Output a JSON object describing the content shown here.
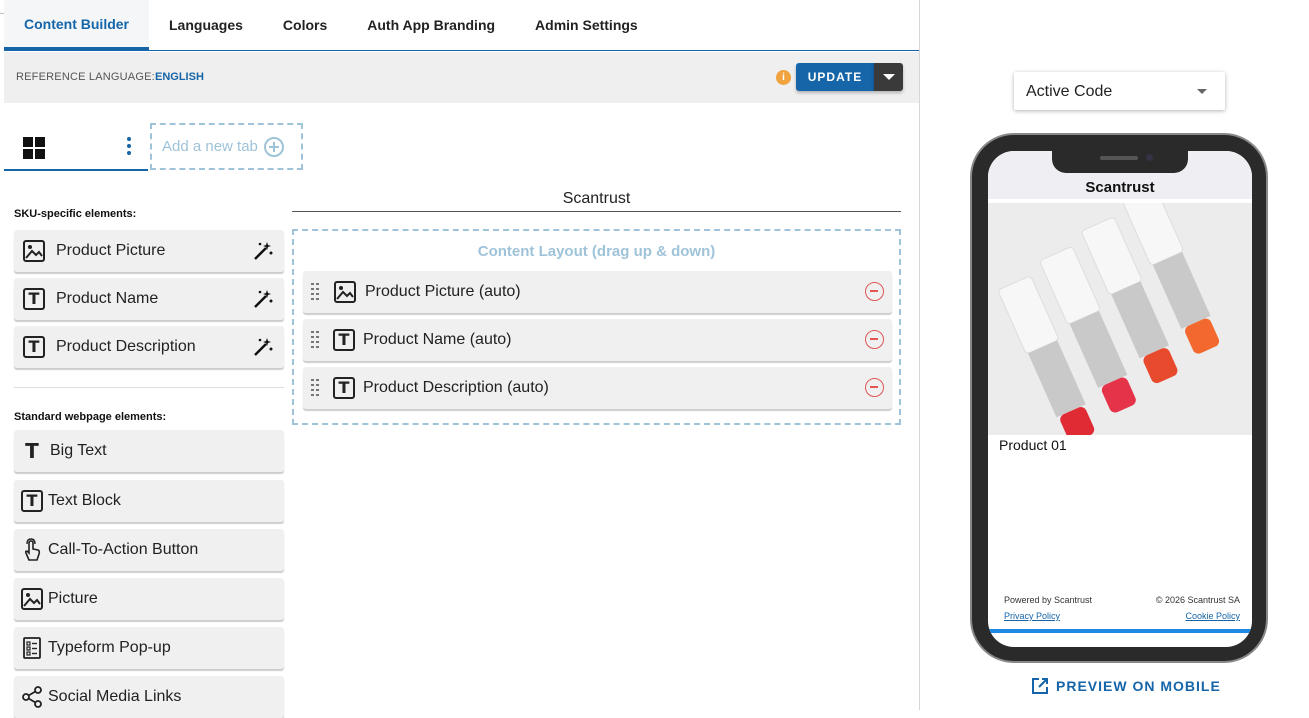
{
  "top_tabs": [
    {
      "label": "Content Builder",
      "active": true
    },
    {
      "label": "Languages",
      "active": false
    },
    {
      "label": "Colors",
      "active": false
    },
    {
      "label": "Auth App Branding",
      "active": false
    },
    {
      "label": "Admin Settings",
      "active": false
    }
  ],
  "reference": {
    "label": "REFERENCE LANGUAGE:",
    "value": "ENGLISH",
    "info_icon": "i",
    "update_label": "UPDATE"
  },
  "inner_tabs": {
    "add_tab_label": "Add a new tab"
  },
  "palette": {
    "sku_title": "SKU-specific elements:",
    "sku_items": [
      {
        "label": "Product Picture",
        "icon": "image-icon"
      },
      {
        "label": "Product Name",
        "icon": "text-box-icon"
      },
      {
        "label": "Product Description",
        "icon": "text-box-icon"
      }
    ],
    "standard_title": "Standard webpage elements:",
    "standard_items": [
      {
        "label": "Big Text",
        "icon": "big-text-icon"
      },
      {
        "label": "Text Block",
        "icon": "text-box-icon"
      },
      {
        "label": "Call-To-Action Button",
        "icon": "tap-icon"
      },
      {
        "label": "Picture",
        "icon": "image-icon"
      },
      {
        "label": "Typeform Pop-up",
        "icon": "form-icon"
      },
      {
        "label": "Social Media Links",
        "icon": "share-icon"
      }
    ]
  },
  "canvas": {
    "title": "Scantrust",
    "layout_title": "Content Layout (drag up & down)",
    "items": [
      {
        "label": "Product Picture (auto)",
        "icon": "image-icon"
      },
      {
        "label": "Product Name (auto)",
        "icon": "text-box-icon"
      },
      {
        "label": "Product Description (auto)",
        "icon": "text-box-icon"
      }
    ]
  },
  "preview": {
    "select_value": "Active Code",
    "phone_title": "Scantrust",
    "product_name": "Product 01",
    "powered_by": "Powered by Scantrust",
    "copyright": "© 2026 Scantrust SA",
    "privacy": "Privacy Policy",
    "cookie": "Cookie Policy",
    "preview_link": "PREVIEW ON MOBILE"
  },
  "colors": {
    "accent": "#1565a8",
    "dashed": "#9fc3d9",
    "remove": "#e05555",
    "info": "#f0a33e"
  }
}
